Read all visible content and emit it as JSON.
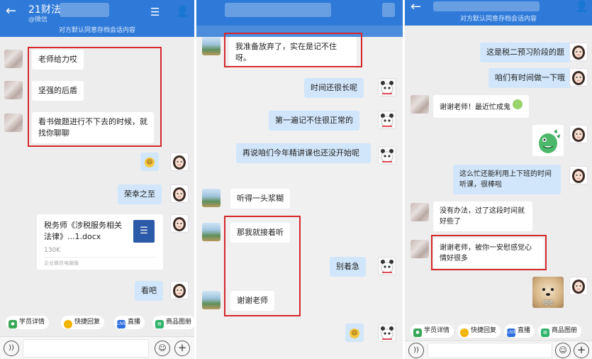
{
  "common": {
    "back_glyph": "←",
    "user_glyph": "👤",
    "menu_glyph": "☰",
    "notice": "对方默认同意存档会话内容",
    "quick": {
      "student_detail": "学员详情",
      "quick_reply": "快捷回复",
      "live": "直播",
      "live_icon_text": "LIVE",
      "product_album": "商品图册"
    },
    "emoji_smile": "😄",
    "emoji_face": "☺",
    "plus": "+",
    "voice": "))"
  },
  "panel1": {
    "title": "21财法",
    "subtitle": "@微信",
    "messages": [
      "老师给力哎",
      "坚强的后盾",
      "看书做题进行不下去的时候，就找你聊聊",
      "荣幸之至",
      "看吧"
    ],
    "file": {
      "name": "税务师《涉税服务相关法律》...1.docx",
      "size": "130K",
      "source": "企业微信电脑版"
    }
  },
  "panel2": {
    "messages": [
      "我准备放弃了，实在是记不住呀。",
      "时间还很长呢",
      "第一遍记不住很正常的",
      "再说咱们今年精讲课也还没开始呢",
      "听得一头浆糊",
      "那我就接着听",
      "别着急",
      "谢谢老师"
    ]
  },
  "panel3": {
    "messages": [
      "这是税二预习阶段的题",
      "咱们有时间做一下哦",
      "谢谢老师！最近忙成鬼",
      "这么忙还能利用上下班的时间听课，很棒啦",
      "没有办法，过了这段时间就好些了",
      "谢谢老师，被你一安慰感觉心情好很多"
    ],
    "dog_caption": "嗯嗯"
  },
  "colors": {
    "header": "#2f7ad9",
    "outgoing_bubble": "#d1e6fb",
    "highlight_box": "#d6272a"
  }
}
